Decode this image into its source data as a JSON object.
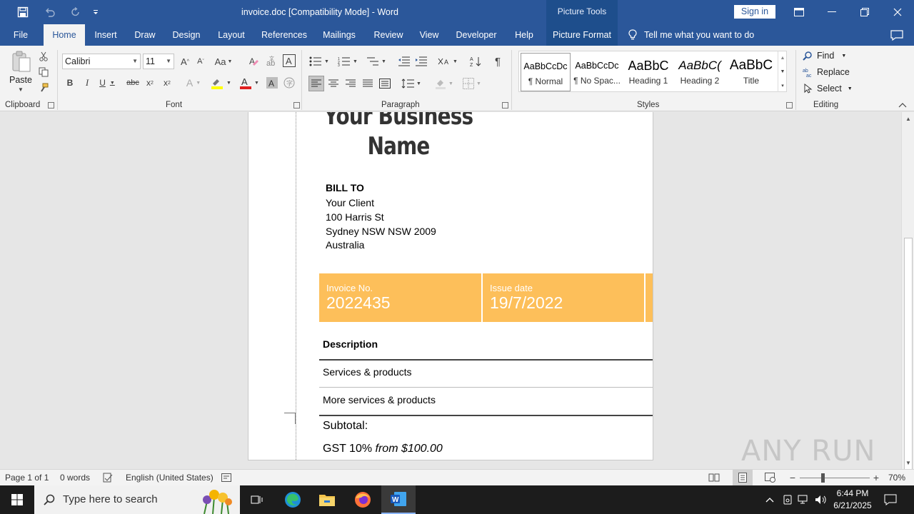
{
  "window": {
    "doc_title": "invoice.doc [Compatibility Mode]  -  Word",
    "picture_tools": "Picture Tools",
    "sign_in": "Sign in"
  },
  "tabs": [
    "File",
    "Home",
    "Insert",
    "Draw",
    "Design",
    "Layout",
    "References",
    "Mailings",
    "Review",
    "View",
    "Developer",
    "Help",
    "Picture Format"
  ],
  "tell_me": "Tell me what you want to do",
  "ribbon": {
    "clipboard": {
      "paste": "Paste",
      "label": "Clipboard"
    },
    "font": {
      "name": "Calibri",
      "size": "11",
      "label": "Font",
      "case": "Aa"
    },
    "paragraph": {
      "label": "Paragraph"
    },
    "styles": {
      "label": "Styles",
      "items": [
        {
          "preview": "AaBbCcDc",
          "name": "¶ Normal"
        },
        {
          "preview": "AaBbCcDc",
          "name": "¶ No Spac..."
        },
        {
          "preview": "AaBbC",
          "name": "Heading 1"
        },
        {
          "preview": "AaBbC(",
          "name": "Heading 2"
        },
        {
          "preview": "AaBbC",
          "name": "Title"
        }
      ]
    },
    "editing": {
      "label": "Editing",
      "find": "Find",
      "replace": "Replace",
      "select": "Select"
    }
  },
  "document": {
    "business_name": "Your Business Name",
    "business_name_line1": "Your Business",
    "business_name_line2": "Name",
    "bill_to_heading": "BILL TO",
    "bill_to_lines": [
      "Your Client",
      "100 Harris St",
      "Sydney NSW NSW 2009",
      "Australia"
    ],
    "invoice_no_label": "Invoice No.",
    "invoice_no": "2022435",
    "issue_date_label": "Issue date",
    "issue_date": "19/7/2022",
    "description_header": "Description",
    "items": [
      "Services & products",
      "More services & products"
    ],
    "subtotal_label": "Subtotal:",
    "gst_label": "GST 10%",
    "gst_from": "from $100.00"
  },
  "status": {
    "page": "Page 1 of 1",
    "words": "0 words",
    "language": "English (United States)",
    "zoom": "70%"
  },
  "taskbar": {
    "search_placeholder": "Type here to search",
    "time": "6:44 PM",
    "date": "6/21/2025"
  },
  "watermark": "ANY RUN",
  "colors": {
    "word_blue": "#2b579a",
    "band": "#fdbf5a"
  }
}
